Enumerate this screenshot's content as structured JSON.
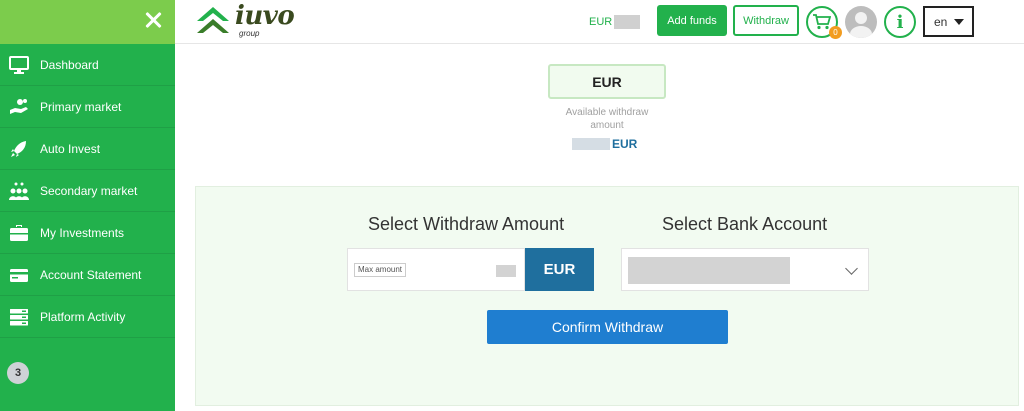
{
  "sidebar": {
    "close_icon": "close-icon",
    "items": [
      {
        "label": "Dashboard",
        "icon": "monitor-icon"
      },
      {
        "label": "Primary market",
        "icon": "hand-coins-icon"
      },
      {
        "label": "Auto Invest",
        "icon": "rocket-icon"
      },
      {
        "label": "Secondary market",
        "icon": "people-exchange-icon"
      },
      {
        "label": "My Investments",
        "icon": "briefcase-icon"
      },
      {
        "label": "Account Statement",
        "icon": "credit-card-icon"
      },
      {
        "label": "Platform Activity",
        "icon": "server-icon"
      }
    ],
    "badge": "3"
  },
  "header": {
    "logo_text": "iuvo",
    "logo_sub": "group",
    "balance_currency": "EUR",
    "add_funds_label": "Add funds",
    "withdraw_label": "Withdraw",
    "cart_count": "0",
    "language": "en"
  },
  "main": {
    "currency": "EUR",
    "available_label": "Available withdraw amount",
    "available_currency": "EUR",
    "amount_title": "Select Withdraw Amount",
    "max_amount_label": "Max amount",
    "amount_currency": "EUR",
    "bank_title": "Select Bank Account",
    "confirm_label": "Confirm Withdraw"
  },
  "colors": {
    "brand_green": "#22b14c",
    "sidebar_top": "#7ccc4c",
    "accent_blue": "#1f6f9e",
    "confirm_blue": "#1f7ed0",
    "panel_bg": "#f2fbf1"
  }
}
